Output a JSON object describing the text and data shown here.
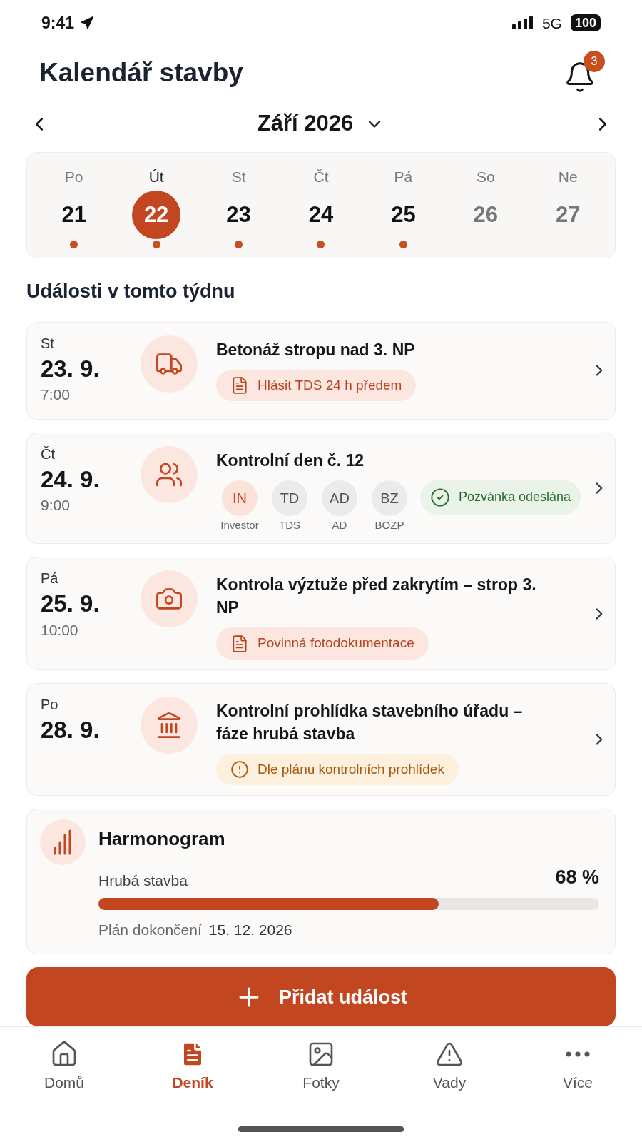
{
  "status_bar": {
    "time": "9:41",
    "network": "5G",
    "battery": "100"
  },
  "header": {
    "title": "Kalendář stavby",
    "notification_count": "3"
  },
  "month_nav": {
    "label": "Září 2026"
  },
  "week": [
    {
      "weekday": "Po",
      "day": "21",
      "selected": false,
      "has_event": true,
      "dimmed": false
    },
    {
      "weekday": "Út",
      "day": "22",
      "selected": true,
      "has_event": true,
      "dimmed": false
    },
    {
      "weekday": "St",
      "day": "23",
      "selected": false,
      "has_event": true,
      "dimmed": false
    },
    {
      "weekday": "Čt",
      "day": "24",
      "selected": false,
      "has_event": true,
      "dimmed": false
    },
    {
      "weekday": "Pá",
      "day": "25",
      "selected": false,
      "has_event": true,
      "dimmed": false
    },
    {
      "weekday": "So",
      "day": "26",
      "selected": false,
      "has_event": false,
      "dimmed": true
    },
    {
      "weekday": "Ne",
      "day": "27",
      "selected": false,
      "has_event": false,
      "dimmed": true
    }
  ],
  "section_title": "Události v tomto týdnu",
  "events": [
    {
      "weekday": "St",
      "date": "23. 9.",
      "time": "7:00",
      "kind": "truck",
      "title": "Betonáž stropu nad 3. NP",
      "tag": {
        "kind": "note",
        "text": "Hlásit TDS 24 h předem"
      }
    },
    {
      "weekday": "Čt",
      "date": "24. 9.",
      "time": "9:00",
      "kind": "people",
      "title": "Kontrolní den č. 12",
      "attendees": [
        {
          "initials": "IN",
          "label": "Investor",
          "highlighted": true
        },
        {
          "initials": "TD",
          "label": "TDS",
          "highlighted": false
        },
        {
          "initials": "AD",
          "label": "AD",
          "highlighted": false
        },
        {
          "initials": "BZ",
          "label": "BOZP",
          "highlighted": false
        }
      ],
      "status": {
        "kind": "success",
        "text": "Pozvánka odeslána"
      }
    },
    {
      "weekday": "Pá",
      "date": "25. 9.",
      "time": "10:00",
      "kind": "camera",
      "title": "Kontrola výztuže před zakrytím – strop 3. NP",
      "tag": {
        "kind": "note",
        "text": "Povinná fotodokumentace"
      }
    },
    {
      "weekday": "Po",
      "date": "28. 9.",
      "kind": "building",
      "title": "Kontrolní prohlídka stavebního úřadu – fáze hrubá stavba",
      "tag": {
        "kind": "warning",
        "text": "Dle plánu kontrolních prohlídek"
      }
    }
  ],
  "schedule": {
    "title": "Harmonogram",
    "phase": "Hrubá stavba",
    "percent": "68 %",
    "level": 0.68,
    "plan_label": "Plán dokončení",
    "plan_date": "15. 12. 2026"
  },
  "add_button": {
    "label": "Přidat událost"
  },
  "tab_bar": [
    {
      "kind": "home",
      "label": "Domů",
      "selected": false
    },
    {
      "kind": "diary",
      "label": "Deník",
      "selected": true
    },
    {
      "kind": "photos",
      "label": "Fotky",
      "selected": false
    },
    {
      "kind": "warning",
      "label": "Vady",
      "selected": false
    },
    {
      "kind": "more",
      "label": "Více",
      "selected": false
    }
  ]
}
